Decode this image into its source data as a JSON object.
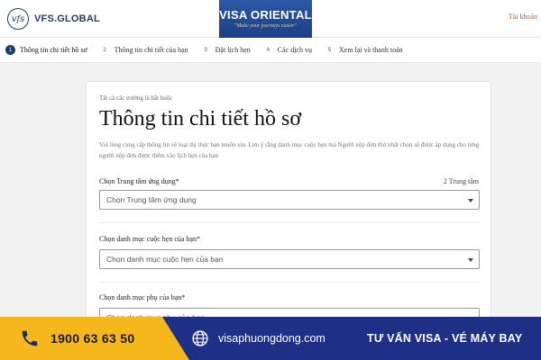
{
  "header": {
    "logo_mark": "vfs",
    "logo_text": "VFS.GLOBAL",
    "banner_title": "VISA ORIENTAL",
    "banner_tagline": "\"Make your journeys easier\"",
    "account_link": "Tài khoản"
  },
  "steps": [
    {
      "num": "1",
      "label": "Thông tin chi tiết hồ sơ",
      "active": true
    },
    {
      "num": "2",
      "label": "Thông tin chi tiết của bạn",
      "active": false
    },
    {
      "num": "3",
      "label": "Đặt lịch hẹn",
      "active": false
    },
    {
      "num": "4",
      "label": "Các dịch vụ",
      "active": false
    },
    {
      "num": "5",
      "label": "Xem lại và thanh toán",
      "active": false
    }
  ],
  "form": {
    "required_note": "Tất cả các trường là bắt buộc",
    "title": "Thông tin chi tiết hồ sơ",
    "description": "Vui lòng cung cấp thông tin về loại thị thực bạn muốn xin. Lưu ý rằng danh mục cuộc hẹn mà Người nộp đơn thứ nhất chọn sẽ được áp dụng cho từng người nộp đơn được thêm vào lịch hẹn của bạn",
    "center_label": "Chọn Trung tâm ứng dụng*",
    "center_count": "2 Trung tâm",
    "center_placeholder": "Chọn Trung tâm ứng dụng",
    "category_label": "Chọn danh mục cuộc hẹn của bạn*",
    "category_placeholder": "Chọn danh mục cuộc hẹn của bạn",
    "subcategory_label": "Chọn danh mục phụ của bạn*",
    "subcategory_placeholder": "Chọn danh mục phụ của bạn"
  },
  "footer": {
    "phone": "1900 63 63 50",
    "website": "visaphuongdong.com",
    "service": "TƯ VẤN VISA - VÉ MÁY BAY"
  },
  "colors": {
    "brand_navy": "#1d3c6e",
    "banner_blue": "#1e2f86",
    "banner_yellow": "#f5b71c",
    "account_orange": "#c85a1a"
  }
}
